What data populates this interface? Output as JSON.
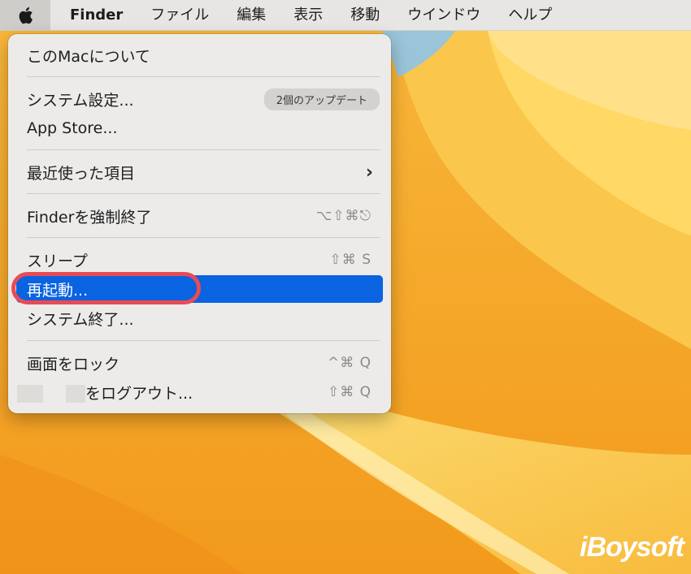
{
  "menubar": {
    "app_name": "Finder",
    "items": [
      "ファイル",
      "編集",
      "表示",
      "移動",
      "ウインドウ",
      "ヘルプ"
    ]
  },
  "apple_menu": {
    "about": "このMacについて",
    "system_settings": "システム設定...",
    "update_badge": "2個のアップデート",
    "app_store": "App Store...",
    "recent_items": "最近使った項目",
    "force_quit": "Finderを強制終了",
    "force_quit_shortcut": "⌥⇧⌘⎋",
    "sleep": "スリープ",
    "sleep_shortcut": "⇧⌘ S",
    "restart": "再起動...",
    "shutdown": "システム終了...",
    "lock_screen": "画面をロック",
    "lock_screen_shortcut": "^⌘ Q",
    "logout": "をログアウト...",
    "logout_shortcut": "⇧⌘ Q"
  },
  "watermark": "iBoysoft",
  "colors": {
    "selection": "#0a63e0",
    "highlight_ring": "#e94b55"
  }
}
